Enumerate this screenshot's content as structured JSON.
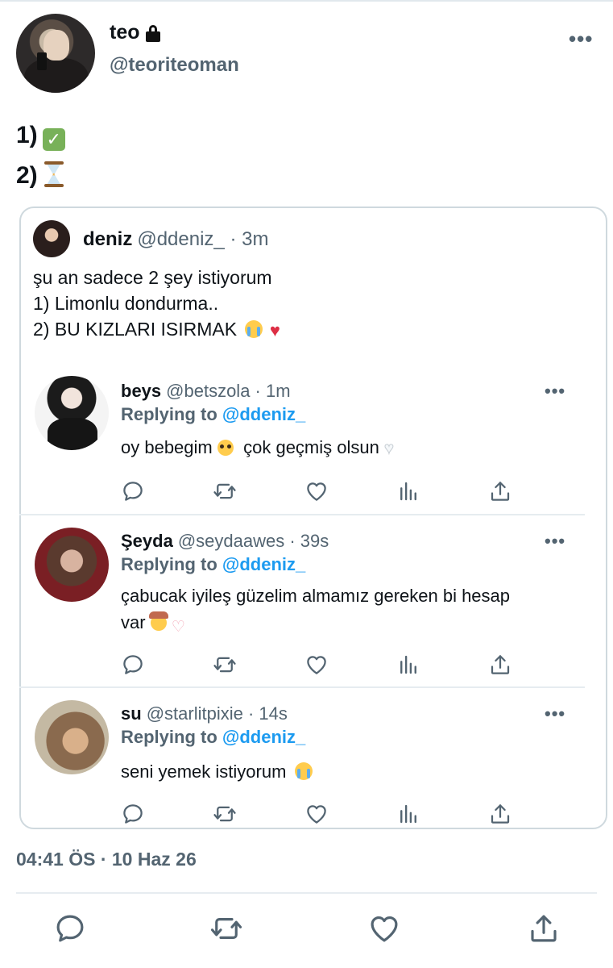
{
  "main_tweet": {
    "name": "teo",
    "handle": "@teoriteoman",
    "lines": [
      "1)",
      "2)"
    ],
    "timestamp": "04:41 ÖS · 10 Haz 26"
  },
  "quoted_tweet": {
    "name": "deniz",
    "meta": "@ddeniz_ · 3m",
    "lines": [
      "şu an sadece 2 şey istiyorum",
      "1) Limonlu dondurma..",
      "2) BU KIZLARI ISIRMAK"
    ]
  },
  "replies": [
    {
      "name": "beys",
      "meta": "@betszola · 1m",
      "replying_prefix": "Replying to",
      "mention": "@ddeniz_",
      "text_a": "oy bebegim",
      "text_b": "çok geçmiş olsun"
    },
    {
      "name": "Şeyda",
      "meta": "@seydaawes · 39s",
      "replying_prefix": "Replying to",
      "mention": "@ddeniz_",
      "text_a": "çabucak iyileş güzelim almamız gereken bi hesap",
      "text_b": "var"
    },
    {
      "name": "su",
      "meta": "@starlitpixie · 14s",
      "replying_prefix": "Replying to",
      "mention": "@ddeniz_",
      "text_a": "seni yemek istiyorum"
    }
  ],
  "icons": {
    "more": "•••",
    "actions": [
      "reply-icon",
      "retweet-icon",
      "like-icon",
      "views-icon",
      "share-icon"
    ]
  },
  "colors": {
    "accent": "#1d9bf0",
    "muted": "#536471",
    "border": "#cfd9de"
  }
}
